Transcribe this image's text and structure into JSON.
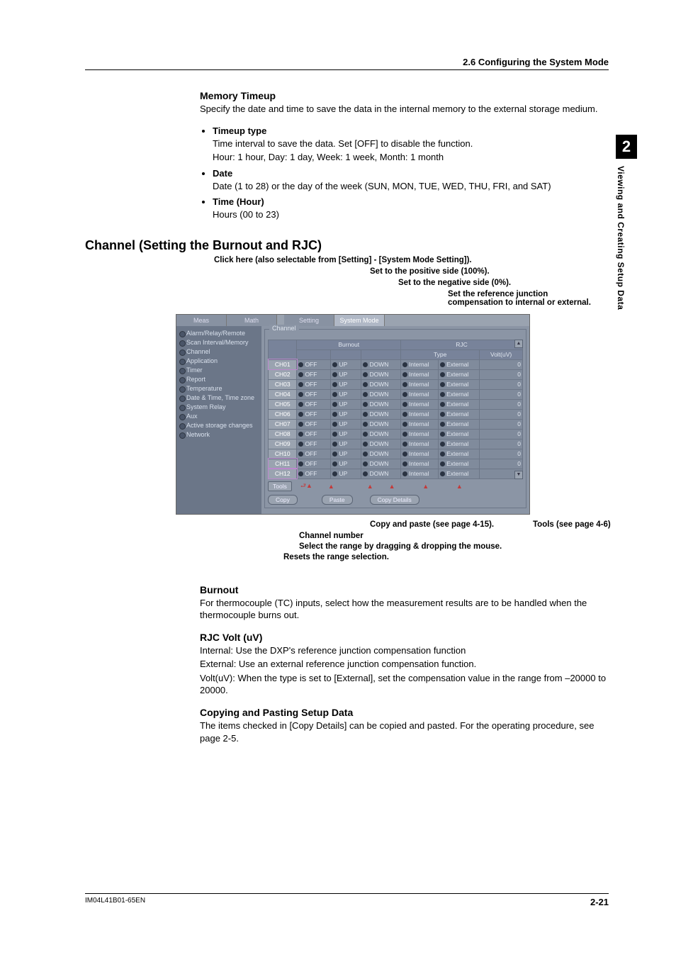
{
  "header": {
    "section": "2.6  Configuring the System Mode"
  },
  "sideTab": {
    "number": "2",
    "label": "Viewing and Creating Setup Data"
  },
  "memoryTimeup": {
    "title": "Memory Timeup",
    "intro": "Specify the date and time to save the data in the internal memory to the external storage medium.",
    "bullets": [
      {
        "title": "Timeup type",
        "body1": "Time interval to save the data. Set [OFF] to disable the function.",
        "body2": "Hour: 1 hour, Day: 1 day, Week: 1 week, Month: 1 month"
      },
      {
        "title": "Date",
        "body1": "Date (1 to 28) or the day of the week (SUN, MON, TUE, WED, THU, FRI, and SAT)"
      },
      {
        "title": "Time (Hour)",
        "body1": "Hours (00 to 23)"
      }
    ]
  },
  "channelSection": {
    "title": "Channel (Setting the Burnout and RJC)"
  },
  "annotTop": {
    "l1": "Click here (also selectable from [Setting] - [System Mode Setting]).",
    "l2": "Set to the positive side (100%).",
    "l3": "Set to the negative side (0%).",
    "l4": "Set the reference junction",
    "l5": "compensation to internal or external."
  },
  "mockTabs": [
    "Meas",
    "Math",
    "Setting",
    "System Mode"
  ],
  "sidebarItems": [
    "Alarm/Relay/Remote",
    "Scan Interval/Memory",
    "Channel",
    "Application",
    "Timer",
    "Report",
    "Temperature",
    "Date & Time, Time zone",
    "System Relay",
    "Aux",
    "Active storage changes",
    "Network"
  ],
  "groupLegend": "Channel",
  "headers": {
    "burnout": "Burnout",
    "rjc": "RJC",
    "type": "Type",
    "volt": "Volt(uV)"
  },
  "rowTemplate": {
    "off": "OFF",
    "up": "UP",
    "down": "DOWN",
    "internal": "Internal",
    "external": "External",
    "volt": "0"
  },
  "channels": [
    "CH01",
    "CH02",
    "CH03",
    "CH04",
    "CH05",
    "CH06",
    "CH07",
    "CH08",
    "CH09",
    "CH10",
    "CH11",
    "CH12"
  ],
  "toolbarBtns": {
    "tools": "Tools",
    "copy": "Copy",
    "paste": "Paste",
    "copyDetails": "Copy Details"
  },
  "annotBelow": {
    "copyPaste": "Copy and paste (see page 4-15).",
    "tools": "Tools (see page 4-6)",
    "chnum": "Channel number",
    "select": "Select the range by dragging & dropping the mouse.",
    "resets": "Resets the range selection."
  },
  "burnout": {
    "title": "Burnout",
    "body": "For thermocouple (TC) inputs, select how the measurement results are to be handled when the thermocouple burns out."
  },
  "rjc": {
    "title": "RJC  Volt (uV)",
    "l1": "Internal: Use the DXP's reference junction compensation function",
    "l2": "External: Use an external reference junction compensation function.",
    "l3": "Volt(uV): When the type is set to [External], set the compensation value in the range from –20000 to 20000."
  },
  "copying": {
    "title": "Copying and Pasting Setup Data",
    "body": "The items checked in [Copy Details] can be copied and pasted. For the operating procedure, see page 2-5."
  },
  "footer": {
    "docId": "IM04L41B01-65EN",
    "pageNum": "2-21"
  }
}
